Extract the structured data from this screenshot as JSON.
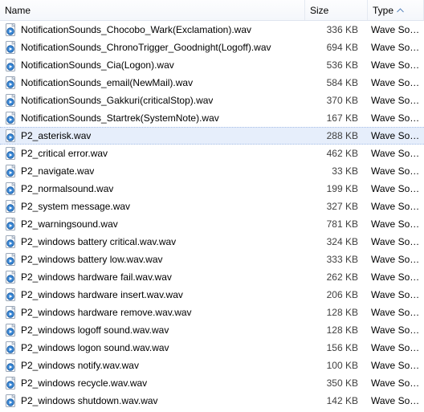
{
  "columns": {
    "name": "Name",
    "size": "Size",
    "type": "Type",
    "sort": "asc"
  },
  "selected_index": 6,
  "files": [
    {
      "name": "NotificationSounds_Chocobo_Wark(Exclamation).wav",
      "size": "336 KB",
      "type": "Wave Sound"
    },
    {
      "name": "NotificationSounds_ChronoTrigger_Goodnight(Logoff).wav",
      "size": "694 KB",
      "type": "Wave Sound"
    },
    {
      "name": "NotificationSounds_Cia(Logon).wav",
      "size": "536 KB",
      "type": "Wave Sound"
    },
    {
      "name": "NotificationSounds_email(NewMail).wav",
      "size": "584 KB",
      "type": "Wave Sound"
    },
    {
      "name": "NotificationSounds_Gakkuri(criticalStop).wav",
      "size": "370 KB",
      "type": "Wave Sound"
    },
    {
      "name": "NotificationSounds_Startrek(SystemNote).wav",
      "size": "167 KB",
      "type": "Wave Sound"
    },
    {
      "name": "P2_asterisk.wav",
      "size": "288 KB",
      "type": "Wave Sound"
    },
    {
      "name": "P2_critical error.wav",
      "size": "462 KB",
      "type": "Wave Sound"
    },
    {
      "name": "P2_navigate.wav",
      "size": "33 KB",
      "type": "Wave Sound"
    },
    {
      "name": "P2_normalsound.wav",
      "size": "199 KB",
      "type": "Wave Sound"
    },
    {
      "name": "P2_system message.wav",
      "size": "327 KB",
      "type": "Wave Sound"
    },
    {
      "name": "P2_warningsound.wav",
      "size": "781 KB",
      "type": "Wave Sound"
    },
    {
      "name": "P2_windows battery critical.wav.wav",
      "size": "324 KB",
      "type": "Wave Sound"
    },
    {
      "name": "P2_windows battery low.wav.wav",
      "size": "333 KB",
      "type": "Wave Sound"
    },
    {
      "name": "P2_windows hardware fail.wav.wav",
      "size": "262 KB",
      "type": "Wave Sound"
    },
    {
      "name": "P2_windows hardware insert.wav.wav",
      "size": "206 KB",
      "type": "Wave Sound"
    },
    {
      "name": "P2_windows hardware remove.wav.wav",
      "size": "128 KB",
      "type": "Wave Sound"
    },
    {
      "name": "P2_windows logoff sound.wav.wav",
      "size": "128 KB",
      "type": "Wave Sound"
    },
    {
      "name": "P2_windows logon sound.wav.wav",
      "size": "156 KB",
      "type": "Wave Sound"
    },
    {
      "name": "P2_windows notify.wav.wav",
      "size": "100 KB",
      "type": "Wave Sound"
    },
    {
      "name": "P2_windows recycle.wav.wav",
      "size": "350 KB",
      "type": "Wave Sound"
    },
    {
      "name": "P2_windows shutdown.wav.wav",
      "size": "142 KB",
      "type": "Wave Sound"
    }
  ]
}
